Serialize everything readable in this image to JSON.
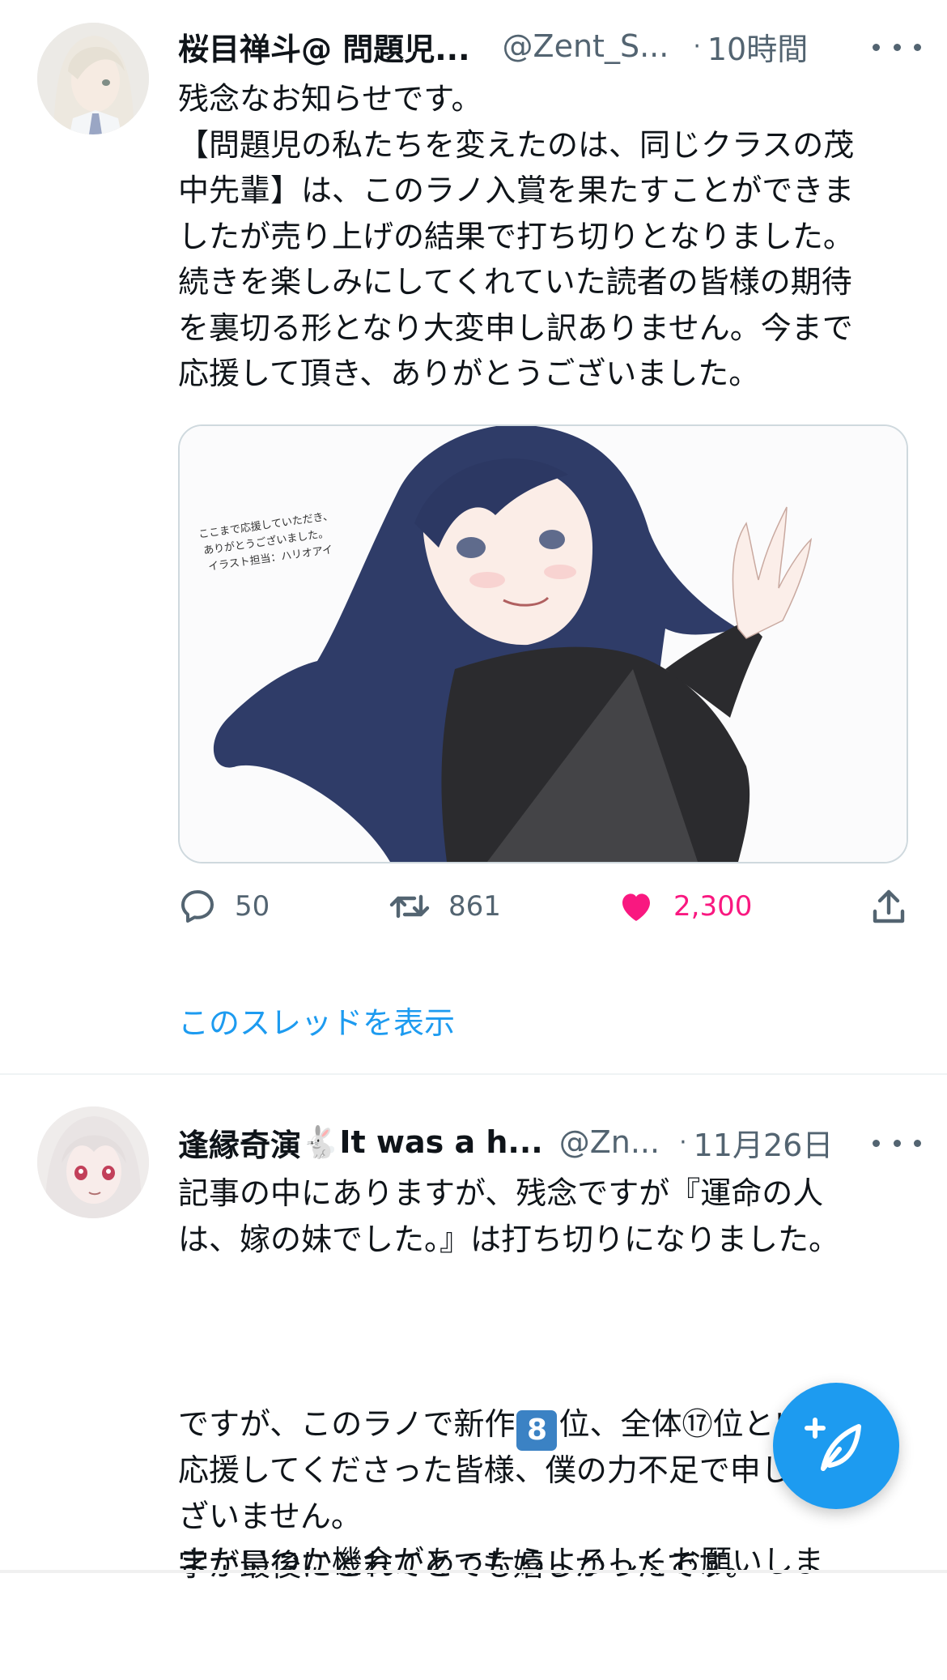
{
  "tweets": [
    {
      "display_name": "桜目禅斗@ 問題児...",
      "handle": "@Zent_S...",
      "separator": "·",
      "time": "10時間",
      "text": "残念なお知らせです。\n【問題児の私たちを変えたのは、同じクラスの茂\n中先輩】は、このラノ入賞を果たすことができま\nしたが売り上げの結果で打ち切りとなりました。\n続きを楽しみにしてくれていた読者の皆様の期待\nを裏切る形となり大変申し訳ありません。今まで\n応援して頂き、ありがとうございました。",
      "media_caption": [
        "ここまで応援していただき、",
        "ありがとうございました。",
        "イラスト担当：ハリオアイ"
      ],
      "replies": "50",
      "retweets": "861",
      "likes": "2,300",
      "thread_link": "このスレッドを表示"
    },
    {
      "display_name_part1": "逢縁奇演",
      "display_name_emoji": "🐇",
      "display_name_part2": "It was a h...",
      "handle": "@Zn...",
      "separator": "·",
      "time": "11月26日",
      "text_block1": "記事の中にありますが、残念ですが『運命の人\nは、嫁の妹でした。』は打ち切りになりました。",
      "text_block2_part1": "ですが、このラノで新作",
      "text_block2_badge": "8",
      "text_block2_part2": "位、全体⑰位という数",
      "text_block2_line2": "字が最後にとれてとても嬉しかったです。",
      "text_block3": "応援してくださった皆様、僕の力不足で申し訳ご\nざいません。\nまたいつか機会があったらよろしくお願いしま"
    }
  ],
  "icons": {
    "more": "more-horizontal-icon",
    "reply": "reply-icon",
    "retweet": "retweet-icon",
    "like": "heart-icon",
    "share": "share-icon",
    "compose": "compose-tweet-icon"
  },
  "colors": {
    "accent": "#1d9bf0",
    "like": "#f91880",
    "secondary_text": "#536471"
  }
}
